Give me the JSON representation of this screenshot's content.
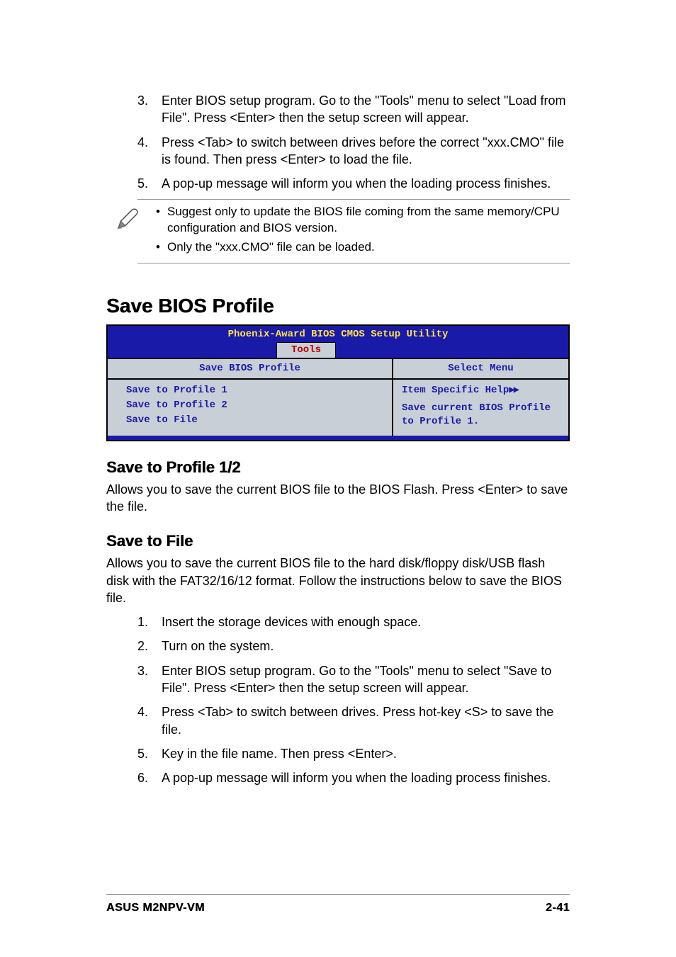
{
  "top_list": {
    "items": [
      {
        "n": "3.",
        "t": "Enter BIOS setup program. Go to the \"Tools\" menu to select \"Load from File\". Press <Enter> then the setup screen will appear."
      },
      {
        "n": "4.",
        "t": "Press <Tab> to switch between drives before the correct \"xxx.CMO\" file is found. Then press <Enter> to load the file."
      },
      {
        "n": "5.",
        "t": "A pop-up message will inform you when the loading process finishes."
      }
    ]
  },
  "note": {
    "items": [
      "Suggest only to update the BIOS file coming from the same memory/CPU configuration and BIOS version.",
      "Only the \"xxx.CMO\" file can be loaded."
    ]
  },
  "section_heading": "Save BIOS Profile",
  "bios": {
    "title": "Phoenix-Award BIOS CMOS Setup Utility",
    "tab": "Tools",
    "left_header": "Save BIOS Profile",
    "right_header": "Select Menu",
    "left_items": [
      "Save to Profile 1",
      "Save to Profile 2",
      "Save to File"
    ],
    "right_help_label": "Item Specific Help",
    "right_help_arrows": "▶▶",
    "right_help_text": "Save current BIOS Profile to Profile 1."
  },
  "sub1": {
    "heading": "Save to Profile 1/2",
    "body": "Allows you to save the current BIOS file to the BIOS Flash. Press <Enter> to save the file."
  },
  "sub2": {
    "heading": "Save to File",
    "body": "Allows you to save the current BIOS file to the hard disk/floppy disk/USB flash disk with the FAT32/16/12 format. Follow the instructions below to save the BIOS file.",
    "steps": [
      {
        "n": "1.",
        "t": "Insert the storage devices with enough space."
      },
      {
        "n": "2.",
        "t": "Turn on the system."
      },
      {
        "n": "3.",
        "t": "Enter BIOS setup program. Go to the \"Tools\" menu to select \"Save to File\". Press <Enter> then the setup screen will appear."
      },
      {
        "n": "4.",
        "t": "Press <Tab> to switch between drives. Press hot-key <S> to save the file."
      },
      {
        "n": "5.",
        "t": "Key in the file name. Then press <Enter>."
      },
      {
        "n": "6.",
        "t": "A pop-up message will inform you when the loading process finishes."
      }
    ]
  },
  "footer": {
    "left": "ASUS M2NPV-VM",
    "right": "2-41"
  }
}
